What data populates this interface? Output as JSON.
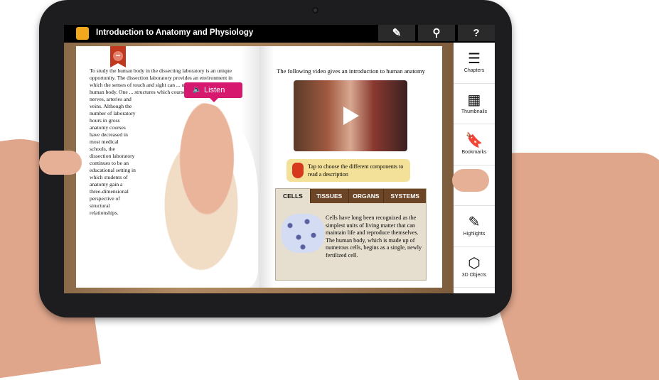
{
  "header": {
    "title": "Introduction to Anatomy and Physiology",
    "buttons": [
      {
        "icon": "pencil-icon",
        "label": "✎"
      },
      {
        "icon": "search-icon",
        "label": "⚲"
      },
      {
        "icon": "help-icon",
        "label": "?"
      }
    ]
  },
  "left_page": {
    "listen_label": "Listen",
    "para_wide": "To study the human body in the dissecting laboratory is an unique opportunity. The dissection laboratory provides an environment in which the senses of touch and sight can ... understanding of the human body. One ... structures which course beneath the skin, e.g.",
    "para_narrow": "nerves, arteries and veins. Although the number of laboratory hours in gross anatomy courses have decreased in most medical schools, the dissection laboratory continues to be an educational setting in which students of anatomy gain a three-dimensional perspective of structural relationships."
  },
  "right_page": {
    "video_title": "The following video gives an introduction to human anatomy",
    "tip": "Tap to choose the different components to read a description",
    "tabs": [
      "CELLS",
      "TISSUES",
      "ORGANS",
      "SYSTEMS"
    ],
    "active_tab": "CELLS",
    "panel_text": "Cells have long been recognized as the simplest units of living matter that can maintain life and reproduce themselves. The human body, which is made up of numerous cells, begins as a single, newly fertilized cell."
  },
  "sidebar": {
    "items": [
      {
        "label": "Chapters",
        "icon": "☰"
      },
      {
        "label": "Thumbnails",
        "icon": "▦"
      },
      {
        "label": "Bookmarks",
        "icon": "🔖"
      },
      {
        "label": "",
        "icon": ""
      },
      {
        "label": "Highlights",
        "icon": "✎"
      },
      {
        "label": "3D Objects",
        "icon": "⬡"
      }
    ]
  },
  "colors": {
    "listen": "#d6196f",
    "tabs": "#6b4526",
    "ribbon": "#c0391f",
    "tip": "#f3e19a"
  }
}
